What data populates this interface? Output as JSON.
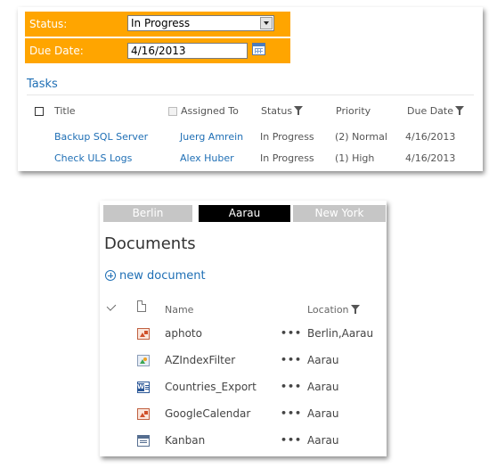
{
  "filters": {
    "status_label": "Status:",
    "status_value": "In Progress",
    "due_label": "Due Date:",
    "due_value": "4/16/2013"
  },
  "tasks": {
    "title": "Tasks",
    "columns": {
      "title": "Title",
      "assigned_to": "Assigned To",
      "status": "Status",
      "priority": "Priority",
      "due_date": "Due Date"
    },
    "rows": [
      {
        "title": "Backup SQL Server",
        "assigned_to": "Juerg Amrein",
        "status": "In Progress",
        "priority": "(2) Normal",
        "due_date": "4/16/2013"
      },
      {
        "title": "Check ULS Logs",
        "assigned_to": "Alex Huber",
        "status": "In Progress",
        "priority": "(1) High",
        "due_date": "4/16/2013"
      }
    ]
  },
  "location_tabs": [
    {
      "label": "Berlin",
      "active": false
    },
    {
      "label": "Aarau",
      "active": true
    },
    {
      "label": "New York",
      "active": false
    }
  ],
  "documents": {
    "title": "Documents",
    "new_document": "new document",
    "columns": {
      "name": "Name",
      "location": "Location"
    },
    "files": [
      {
        "icon": "image-icon-red",
        "name": "aphoto",
        "location": "Berlin,Aarau"
      },
      {
        "icon": "image-icon",
        "name": "AZIndexFilter",
        "location": "Aarau"
      },
      {
        "icon": "word-doc-icon",
        "name": "Countries_Export",
        "location": "Aarau"
      },
      {
        "icon": "image-icon-red",
        "name": "GoogleCalendar",
        "location": "Aarau"
      },
      {
        "icon": "board-icon",
        "name": "Kanban",
        "location": "Aarau"
      }
    ],
    "menu_glyph": "•••"
  },
  "colors": {
    "filter_bg": "#ffa500",
    "link": "#1f6fb5",
    "tab_active": "#000000",
    "tab_inactive": "#c6c6c6"
  }
}
